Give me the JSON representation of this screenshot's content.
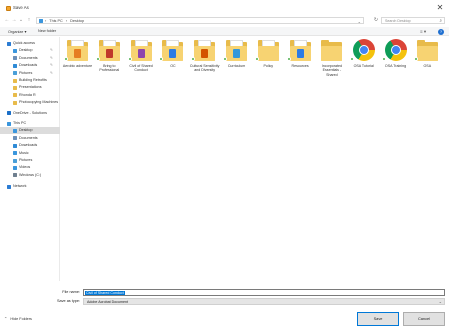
{
  "window": {
    "title": "Save As",
    "close_glyph": "✕"
  },
  "address": {
    "back": "←",
    "forward": "→",
    "up_history": "⌄",
    "up": "↑",
    "crumbs": [
      "This PC",
      "›",
      "Desktop"
    ],
    "crumb_prefix": "›",
    "refresh": "↻",
    "search_placeholder": "Search Desktop"
  },
  "toolbar": {
    "organize": "Organize ▾",
    "new_folder": "New folder",
    "view_icon": "≡ ▾",
    "help": "?"
  },
  "nav": {
    "items": [
      {
        "label": "Quick access",
        "icon": "star-icon",
        "color": "#2b7cd3",
        "indent": 0
      },
      {
        "label": "Desktop",
        "icon": "desktop-icon",
        "color": "#3a96dd",
        "indent": 1,
        "pinned": true
      },
      {
        "label": "Documents",
        "icon": "documents-icon",
        "color": "#6b8fb8",
        "indent": 1,
        "pinned": true
      },
      {
        "label": "Downloads",
        "icon": "downloads-icon",
        "color": "#2e8bd6",
        "indent": 1,
        "pinned": true
      },
      {
        "label": "Pictures",
        "icon": "pictures-icon",
        "color": "#4a9fd8",
        "indent": 1,
        "pinned": true
      },
      {
        "label": "Building Retrofits",
        "icon": "folder-icon",
        "color": "#e8bb4a",
        "indent": 1
      },
      {
        "label": "Presentations",
        "icon": "folder-icon",
        "color": "#e8bb4a",
        "indent": 1
      },
      {
        "label": "Rhonda R",
        "icon": "folder-icon",
        "color": "#e8bb4a",
        "indent": 1
      },
      {
        "label": "Photocopying Machines",
        "icon": "folder-icon",
        "color": "#e8bb4a",
        "indent": 1
      },
      {
        "label": "OneDrive - Solutions",
        "icon": "onedrive-icon",
        "color": "#1b6fc8",
        "indent": 0
      },
      {
        "label": "This PC",
        "icon": "pc-icon",
        "color": "#3a96dd",
        "indent": 0
      },
      {
        "label": "Desktop",
        "icon": "desktop-icon",
        "color": "#3a96dd",
        "indent": 1,
        "selected": true
      },
      {
        "label": "Documents",
        "icon": "documents-icon",
        "color": "#6b8fb8",
        "indent": 1
      },
      {
        "label": "Downloads",
        "icon": "downloads-icon",
        "color": "#2e8bd6",
        "indent": 1
      },
      {
        "label": "Music",
        "icon": "music-icon",
        "color": "#3a96dd",
        "indent": 1
      },
      {
        "label": "Pictures",
        "icon": "pictures-icon",
        "color": "#4a9fd8",
        "indent": 1
      },
      {
        "label": "Videos",
        "icon": "videos-icon",
        "color": "#3a96dd",
        "indent": 1
      },
      {
        "label": "Windows (C:)",
        "icon": "drive-icon",
        "color": "#6f7f8f",
        "indent": 1
      },
      {
        "label": "Network",
        "icon": "network-icon",
        "color": "#2b7cd3",
        "indent": 0
      }
    ]
  },
  "files": [
    {
      "name": "Aerobic adventure",
      "kind": "folder",
      "badge": "#e67e22",
      "synced": true
    },
    {
      "name": "Bring to Professional",
      "kind": "folder",
      "badge": "#c0392b",
      "synced": true
    },
    {
      "name": "Civil of Shared Conduct",
      "kind": "folder",
      "badge": "#8e44ad",
      "synced": true
    },
    {
      "name": "OC",
      "kind": "folder",
      "badge": "#2c7be5",
      "synced": true
    },
    {
      "name": "Cultural Sensitivity and Diversity",
      "kind": "folder",
      "badge": "#d35400",
      "synced": true
    },
    {
      "name": "Curriculum",
      "kind": "folder",
      "badge": "#3498db",
      "synced": true
    },
    {
      "name": "Policy",
      "kind": "folder",
      "badge": "none",
      "synced": true
    },
    {
      "name": "Resources",
      "kind": "folder",
      "badge": "#2c7be5",
      "synced": true
    },
    {
      "name": "Incorporated Essentials - Shared",
      "kind": "folder-plain",
      "badge": "none",
      "synced": false
    },
    {
      "name": "OSA Tutorial",
      "kind": "chrome",
      "badge": "none",
      "synced": true
    },
    {
      "name": "OSA Training",
      "kind": "chrome",
      "badge": "none",
      "synced": true
    },
    {
      "name": "OSA",
      "kind": "folder-plain",
      "badge": "none",
      "synced": true
    }
  ],
  "footer": {
    "filename_label": "File name:",
    "filename_value": "Civil of Shared Conduct",
    "type_label": "Save as type:",
    "type_value": "Adobe Acrobat Document",
    "dropdown": "⌄",
    "hide_folders": "Hide Folders",
    "hide_caret": "⌃",
    "save": "Save",
    "cancel": "Cancel"
  }
}
